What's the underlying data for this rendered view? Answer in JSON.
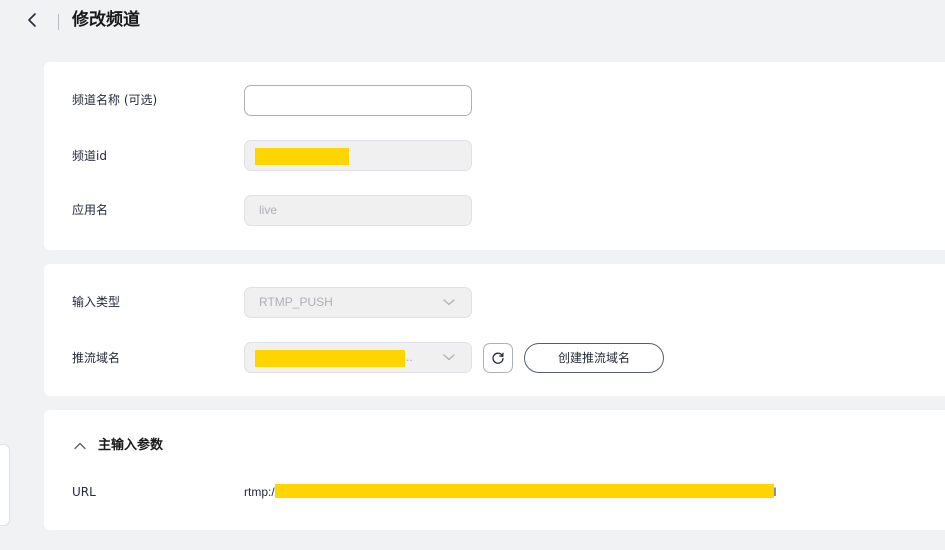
{
  "header": {
    "title": "修改频道"
  },
  "basic": {
    "channel_name_label": "频道名称 (可选)",
    "channel_name_value": "",
    "channel_id_label": "频道id",
    "app_name_label": "应用名",
    "app_name_value": "live"
  },
  "input": {
    "input_type_label": "输入类型",
    "input_type_value": "RTMP_PUSH",
    "push_domain_label": "推流域名",
    "push_domain_ellipsis": "..",
    "create_domain_button": "创建推流域名"
  },
  "main_input": {
    "section_title": "主输入参数",
    "url_label": "URL",
    "url_prefix": "rtmp:/",
    "url_suffix": "l"
  },
  "colors": {
    "redaction": "#ffd500",
    "page_background": "#f1f2f4",
    "card_background": "#ffffff"
  }
}
